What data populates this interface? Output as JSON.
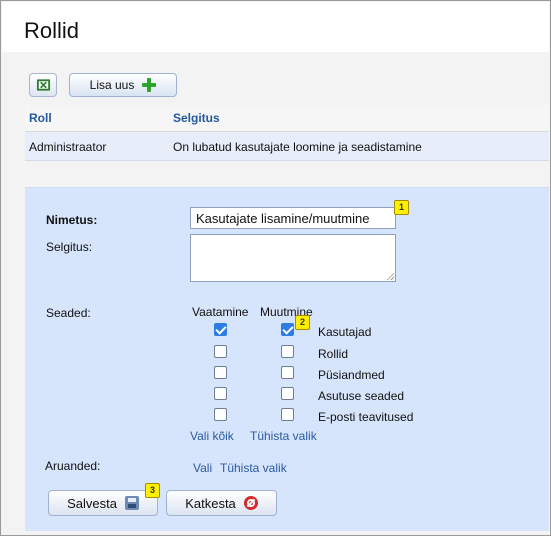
{
  "page": {
    "title": "Rollid"
  },
  "toolbar": {
    "add_label": "Lisa uus"
  },
  "table": {
    "headers": [
      "Roll",
      "Selgitus"
    ],
    "rows": [
      [
        "Administraator",
        "On lubatud kasutajate loomine ja seadistamine"
      ]
    ]
  },
  "form": {
    "name_label": "Nimetus:",
    "name_value": "Kasutajate lisamine/muutmine",
    "description_label": "Selgitus:",
    "settings_label": "Seaded:",
    "view_header": "Vaatamine",
    "edit_header": "Muutmine",
    "permissions": [
      {
        "label": "Kasutajad",
        "view": true,
        "edit": true
      },
      {
        "label": "Rollid",
        "view": false,
        "edit": false
      },
      {
        "label": "Püsiandmed",
        "view": false,
        "edit": false
      },
      {
        "label": "Asutuse seaded",
        "view": false,
        "edit": false
      },
      {
        "label": "E-posti teavitused",
        "view": false,
        "edit": false
      }
    ],
    "select_all": "Vali kõik",
    "clear_selection": "Tühista valik",
    "reports_label": "Aruanded:",
    "reports_select": "Vali",
    "reports_clear": "Tühista valik",
    "save_label": "Salvesta",
    "cancel_label": "Katkesta"
  },
  "annotations": {
    "name": "1",
    "permission": "2",
    "save": "3"
  },
  "colors": {
    "accent": "#25589c",
    "form_background": "#d6e5fb",
    "selected_row": "#e7eef9"
  }
}
